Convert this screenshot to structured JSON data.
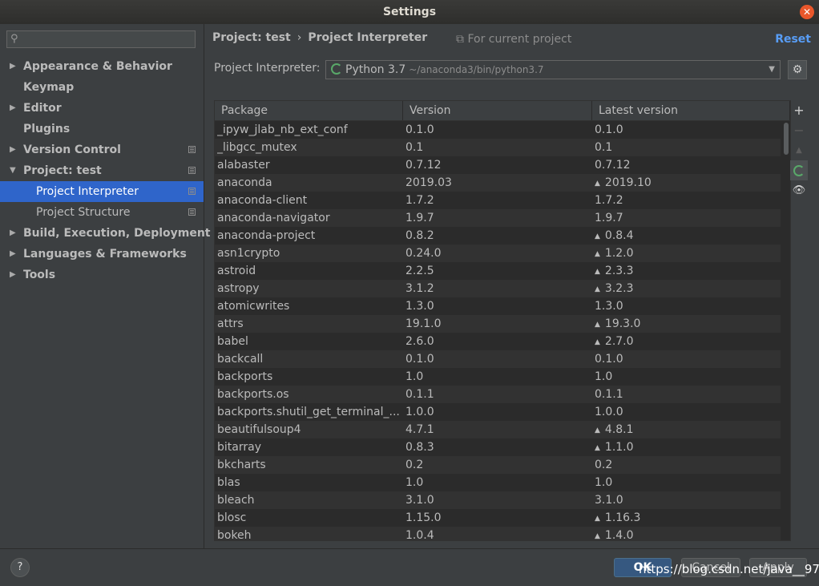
{
  "window": {
    "title": "Settings",
    "close_glyph": "✕"
  },
  "sidebar": {
    "search_placeholder": "",
    "items": [
      {
        "label": "Appearance & Behavior",
        "arrow": "▶",
        "bold": true
      },
      {
        "label": "Keymap",
        "arrow": "",
        "bold": true
      },
      {
        "label": "Editor",
        "arrow": "▶",
        "bold": true
      },
      {
        "label": "Plugins",
        "arrow": "",
        "bold": true
      },
      {
        "label": "Version Control",
        "arrow": "▶",
        "bold": true
      },
      {
        "label": "Project: test",
        "arrow": "▼",
        "bold": true
      },
      {
        "label": "Project Interpreter",
        "arrow": "",
        "bold": false
      },
      {
        "label": "Project Structure",
        "arrow": "",
        "bold": false
      },
      {
        "label": "Build, Execution, Deployment",
        "arrow": "▶",
        "bold": true
      },
      {
        "label": "Languages & Frameworks",
        "arrow": "▶",
        "bold": true
      },
      {
        "label": "Tools",
        "arrow": "▶",
        "bold": true
      }
    ]
  },
  "header": {
    "crumb_project": "Project: test",
    "crumb_sep": "›",
    "crumb_page": "Project Interpreter",
    "for_current": "For current project",
    "reset": "Reset"
  },
  "interpreter": {
    "label": "Project Interpreter:",
    "name": "Python 3.7",
    "path": "~/anaconda3/bin/python3.7"
  },
  "table": {
    "columns": [
      "Package",
      "Version",
      "Latest version"
    ],
    "upgrade_glyph": "▲",
    "rows": [
      {
        "package": "_ipyw_jlab_nb_ext_conf",
        "version": "0.1.0",
        "latest": "0.1.0",
        "upgrade": false
      },
      {
        "package": "_libgcc_mutex",
        "version": "0.1",
        "latest": "0.1",
        "upgrade": false
      },
      {
        "package": "alabaster",
        "version": "0.7.12",
        "latest": "0.7.12",
        "upgrade": false
      },
      {
        "package": "anaconda",
        "version": "2019.03",
        "latest": "2019.10",
        "upgrade": true
      },
      {
        "package": "anaconda-client",
        "version": "1.7.2",
        "latest": "1.7.2",
        "upgrade": false
      },
      {
        "package": "anaconda-navigator",
        "version": "1.9.7",
        "latest": "1.9.7",
        "upgrade": false
      },
      {
        "package": "anaconda-project",
        "version": "0.8.2",
        "latest": "0.8.4",
        "upgrade": true
      },
      {
        "package": "asn1crypto",
        "version": "0.24.0",
        "latest": "1.2.0",
        "upgrade": true
      },
      {
        "package": "astroid",
        "version": "2.2.5",
        "latest": "2.3.3",
        "upgrade": true
      },
      {
        "package": "astropy",
        "version": "3.1.2",
        "latest": "3.2.3",
        "upgrade": true
      },
      {
        "package": "atomicwrites",
        "version": "1.3.0",
        "latest": "1.3.0",
        "upgrade": false
      },
      {
        "package": "attrs",
        "version": "19.1.0",
        "latest": "19.3.0",
        "upgrade": true
      },
      {
        "package": "babel",
        "version": "2.6.0",
        "latest": "2.7.0",
        "upgrade": true
      },
      {
        "package": "backcall",
        "version": "0.1.0",
        "latest": "0.1.0",
        "upgrade": false
      },
      {
        "package": "backports",
        "version": "1.0",
        "latest": "1.0",
        "upgrade": false
      },
      {
        "package": "backports.os",
        "version": "0.1.1",
        "latest": "0.1.1",
        "upgrade": false
      },
      {
        "package": "backports.shutil_get_terminal_...",
        "version": "1.0.0",
        "latest": "1.0.0",
        "upgrade": false
      },
      {
        "package": "beautifulsoup4",
        "version": "4.7.1",
        "latest": "4.8.1",
        "upgrade": true
      },
      {
        "package": "bitarray",
        "version": "0.8.3",
        "latest": "1.1.0",
        "upgrade": true
      },
      {
        "package": "bkcharts",
        "version": "0.2",
        "latest": "0.2",
        "upgrade": false
      },
      {
        "package": "blas",
        "version": "1.0",
        "latest": "1.0",
        "upgrade": false
      },
      {
        "package": "bleach",
        "version": "3.1.0",
        "latest": "3.1.0",
        "upgrade": false
      },
      {
        "package": "blosc",
        "version": "1.15.0",
        "latest": "1.16.3",
        "upgrade": true
      },
      {
        "package": "bokeh",
        "version": "1.0.4",
        "latest": "1.4.0",
        "upgrade": true
      }
    ]
  },
  "toolbar": {
    "add": "+",
    "remove": "−",
    "upgrade": "▲",
    "show_early": "👁"
  },
  "footer": {
    "help": "?",
    "ok": "OK",
    "cancel": "Cancel",
    "apply": "Apply",
    "watermark": "https://blog.csdn.net/java__97"
  },
  "colors": {
    "accent": "#2f65ca",
    "link": "#589df6",
    "ok": "#365880",
    "python": "#59a869"
  }
}
